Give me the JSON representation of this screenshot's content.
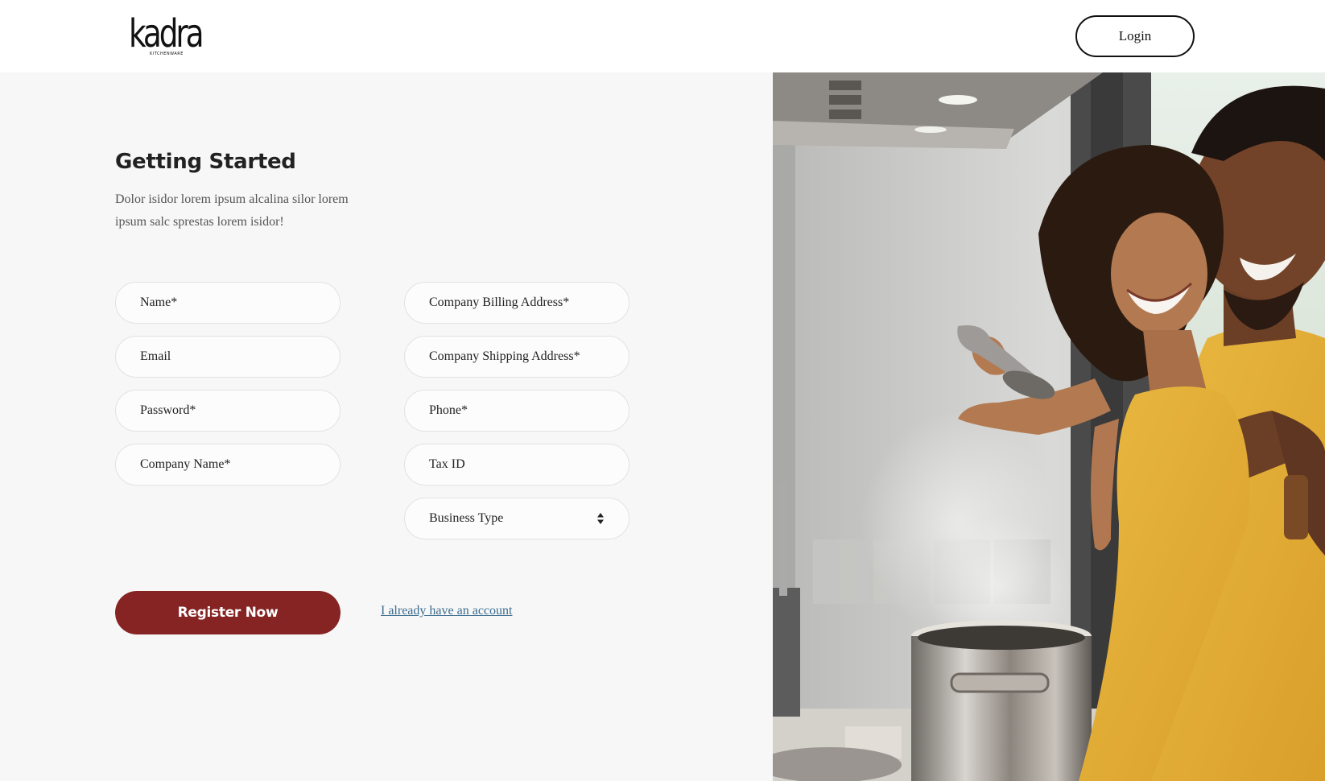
{
  "header": {
    "logo_word": "kadra",
    "logo_sub": "KITCHENWARE",
    "login_label": "Login"
  },
  "form": {
    "title": "Getting Started",
    "subtitle": "Dolor isidor lorem ipsum alcalina silor lorem ipsum salc sprestas lorem isidor!",
    "fields": {
      "name": "Name*",
      "email": "Email",
      "password": "Password*",
      "company_name": "Company Name*",
      "billing_address": "Company Billing Address*",
      "shipping_address": "Company Shipping Address*",
      "phone": "Phone*",
      "tax_id": "Tax ID",
      "business_type": "Business Type"
    },
    "register_label": "Register Now",
    "account_link": "I already have an account"
  },
  "colors": {
    "accent": "#862424",
    "link": "#3b6d8f",
    "panel_bg": "#f7f7f7"
  },
  "icons": {
    "select_arrows": "sort-arrows-icon"
  }
}
